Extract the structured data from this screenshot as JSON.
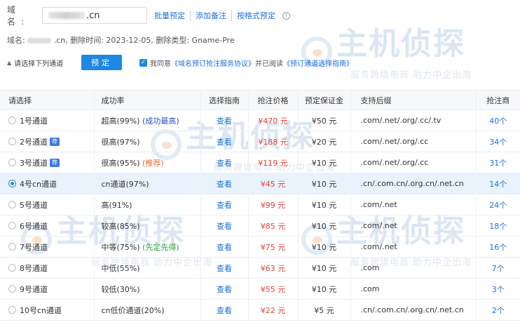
{
  "form": {
    "domain_label": "域 名:",
    "domain_value": ".cn",
    "links": [
      "批量预定",
      "添加备注",
      "按格式预定"
    ],
    "help_icon": "question-circle-icon",
    "info_prefix": "域名:",
    "info_text": ".cn, 删除时间: 2023-12-05, 删除类型: Gname-Pre",
    "channel_select": "请选择下列通道",
    "reserve_button": "预定",
    "agree_prefix": "我同意",
    "agree_link1": "《域名预订抢注服务协议》",
    "agree_mid": "并已阅读",
    "agree_link2": "《预订通道选择指南》",
    "agree_checked": true
  },
  "watermark": {
    "brand": "主机侦探",
    "slogan": "服务跨境电商 助力中企出海"
  },
  "table": {
    "headers": [
      "请选择",
      "成功率",
      "选择指南",
      "抢注价格",
      "预定保证金",
      "支持后缀",
      "抢注商"
    ],
    "rows": [
      {
        "channel": "1号通道",
        "badge": "",
        "rate": "超高(99%)",
        "note": "(成功最高)",
        "note_color": "blue",
        "guide": "查看",
        "price": "¥470 元",
        "deposit": "¥50 元",
        "suffix": ".com/.net/.org/.cc/.tv",
        "count": "40个",
        "selected": false
      },
      {
        "channel": "2号通道",
        "badge": "荐",
        "rate": "很高(97%)",
        "note": "",
        "note_color": "",
        "guide": "查看",
        "price": "¥188 元",
        "deposit": "¥20 元",
        "suffix": ".com/.net/.org/.cc",
        "count": "34个",
        "selected": false
      },
      {
        "channel": "3号通道",
        "badge": "荐",
        "rate": "很高(95%)",
        "note": "(推荐)",
        "note_color": "orange",
        "guide": "查看",
        "price": "¥119 元",
        "deposit": "¥10 元",
        "suffix": ".com/.net/.org/.cc",
        "count": "31个",
        "selected": false
      },
      {
        "channel": "4号cn通道",
        "badge": "",
        "rate": "cn通道(97%)",
        "note": "",
        "note_color": "",
        "guide": "查看",
        "price": "¥45 元",
        "deposit": "¥10 元",
        "suffix": ".cn/.com.cn/.org.cn/.net.cn",
        "count": "14个",
        "selected": true
      },
      {
        "channel": "5号通道",
        "badge": "",
        "rate": "高(91%)",
        "note": "",
        "note_color": "",
        "guide": "查看",
        "price": "¥99 元",
        "deposit": "¥10 元",
        "suffix": ".com/.net",
        "count": "24个",
        "selected": false
      },
      {
        "channel": "6号通道",
        "badge": "",
        "rate": "较高(85%)",
        "note": "",
        "note_color": "",
        "guide": "查看",
        "price": "¥85 元",
        "deposit": "¥10 元",
        "suffix": ".com/.net",
        "count": "18个",
        "selected": false
      },
      {
        "channel": "7号通道",
        "badge": "",
        "rate": "中等(75%)",
        "note": "(先定先得)",
        "note_color": "green",
        "guide": "查看",
        "price": "¥75 元",
        "deposit": "¥10 元",
        "suffix": ".com/.net",
        "count": "16个",
        "selected": false
      },
      {
        "channel": "8号通道",
        "badge": "",
        "rate": "中低(55%)",
        "note": "",
        "note_color": "",
        "guide": "查看",
        "price": "¥63 元",
        "deposit": "¥10 元",
        "suffix": ".com",
        "count": "7个",
        "selected": false
      },
      {
        "channel": "9号通道",
        "badge": "",
        "rate": "较低(30%)",
        "note": "",
        "note_color": "",
        "guide": "查看",
        "price": "¥55 元",
        "deposit": "¥10 元",
        "suffix": ".com",
        "count": "3个",
        "selected": false
      },
      {
        "channel": "10号cn通道",
        "badge": "",
        "rate": "cn低价通道(20%)",
        "note": "",
        "note_color": "",
        "guide": "查看",
        "price": "¥22 元",
        "deposit": "¥5 元",
        "suffix": ".cn/.com.cn/.org.cn/.net.cn",
        "count": "2个",
        "selected": false
      }
    ]
  },
  "colors": {
    "accent": "#1e88e5",
    "link": "#1e6fd9",
    "price": "#e0403a",
    "selected_row": "#e8f3fd"
  }
}
